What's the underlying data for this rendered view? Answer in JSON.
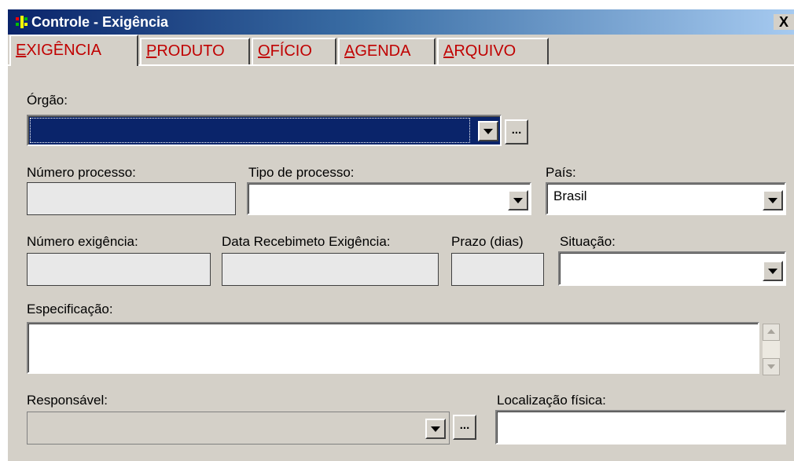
{
  "window": {
    "title": "Controle - Exigência",
    "close_label": "X",
    "colors": {
      "face": "#d4d0c8",
      "title_active": "#0a246a",
      "tab_text": "#c00000"
    }
  },
  "tabs": [
    {
      "mnemonic": "E",
      "rest": "XIGÊNCIA",
      "active": true
    },
    {
      "mnemonic": "P",
      "rest": "RODUTO",
      "active": false
    },
    {
      "mnemonic": "O",
      "rest": "FÍCIO",
      "active": false
    },
    {
      "mnemonic": "A",
      "rest": "GENDA",
      "active": false
    },
    {
      "mnemonic": "A",
      "rest": "RQUIVO",
      "active": false
    }
  ],
  "form": {
    "orgao": {
      "label": "Órgão:",
      "value": "",
      "ellipsis": "..."
    },
    "numero_processo": {
      "label": "Número processo:",
      "value": ""
    },
    "tipo_processo": {
      "label": "Tipo de processo:",
      "value": ""
    },
    "pais": {
      "label": "País:",
      "value": "Brasil"
    },
    "numero_exigencia": {
      "label": "Número exigência:",
      "value": ""
    },
    "data_recebimento": {
      "label": "Data Recebimeto Exigência:",
      "value": ""
    },
    "prazo": {
      "label": "Prazo (dias)",
      "value": ""
    },
    "situacao": {
      "label": "Situação:",
      "value": ""
    },
    "especificacao": {
      "label": "Especificação:",
      "value": ""
    },
    "responsavel": {
      "label": "Responsável:",
      "value": "",
      "ellipsis": "..."
    },
    "localizacao": {
      "label": "Localização física:",
      "value": ""
    }
  }
}
